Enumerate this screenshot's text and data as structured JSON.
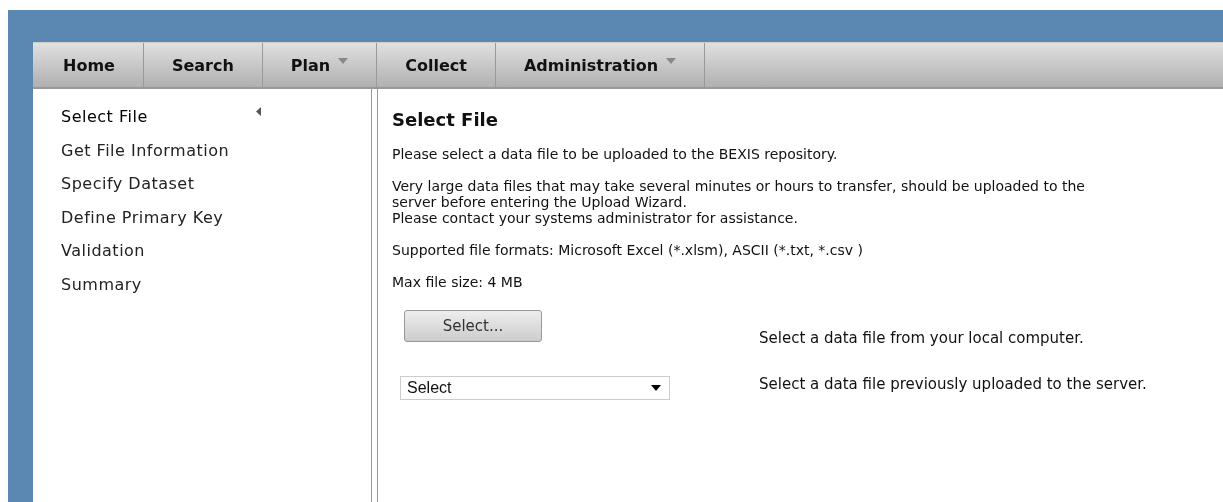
{
  "nav": [
    {
      "label": "Home",
      "dropdown": false
    },
    {
      "label": "Search",
      "dropdown": false
    },
    {
      "label": "Plan",
      "dropdown": true
    },
    {
      "label": "Collect",
      "dropdown": false
    },
    {
      "label": "Administration",
      "dropdown": true
    }
  ],
  "steps": [
    {
      "label": "Select File",
      "selected": true
    },
    {
      "label": "Get File Information",
      "selected": false
    },
    {
      "label": "Specify Dataset",
      "selected": false
    },
    {
      "label": "Define Primary Key",
      "selected": false
    },
    {
      "label": "Validation",
      "selected": false
    },
    {
      "label": "Summary",
      "selected": false
    }
  ],
  "main": {
    "title": "Select File",
    "paragraphs": [
      [
        "Please select a data file to be uploaded to the BEXIS repository."
      ],
      [
        "Very large data files that may take several minutes or hours to transfer, should be uploaded to the server before entering the Upload Wizard.",
        "Please contact your systems administrator for assistance."
      ],
      [
        "Supported file formats: Microsoft Excel (*.xlsm), ASCII (*.txt, *.csv )"
      ],
      [
        "Max file size: 4 MB"
      ]
    ],
    "select_button": "Select...",
    "select_button_hint": "Select a data file from your local computer.",
    "server_dropdown": {
      "value": "Select"
    },
    "server_dropdown_hint": "Select a data file previously uploaded to the server."
  }
}
